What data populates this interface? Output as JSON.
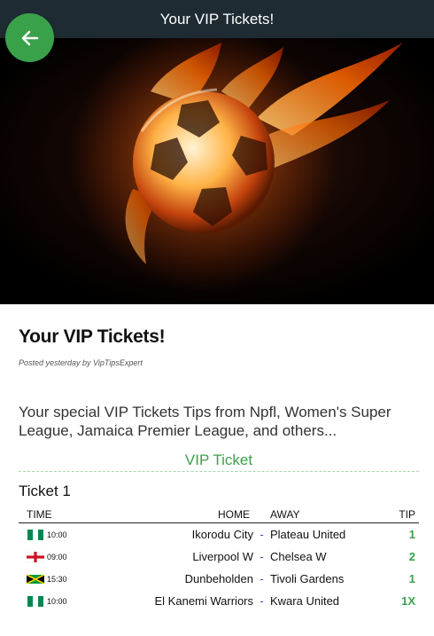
{
  "header": {
    "title": "Your VIP Tickets!"
  },
  "post": {
    "title": "Your VIP Tickets!",
    "meta": "Posted yesterday by VipTipsExpert",
    "intro": "Your special VIP Tickets Tips from Npfl, Women's Super League, Jamaica Premier League, and others..."
  },
  "section": {
    "title": "VIP Ticket"
  },
  "ticket": {
    "name": "Ticket 1",
    "columns": {
      "time": "TIME",
      "home": "HOME",
      "away": "AWAY",
      "tip": "TIP"
    },
    "separator": "-",
    "rows": [
      {
        "flag": "nigeria-flag",
        "time": "10:00",
        "home": "Ikorodu City",
        "away": "Plateau United",
        "tip": "1"
      },
      {
        "flag": "england-flag",
        "time": "09:00",
        "home": "Liverpool W",
        "away": "Chelsea W",
        "tip": "2"
      },
      {
        "flag": "jamaica-flag",
        "time": "15:30",
        "home": "Dunbeholden",
        "away": "Tivoli Gardens",
        "tip": "1"
      },
      {
        "flag": "nigeria-flag",
        "time": "10:00",
        "home": "El Kanemi Warriors",
        "away": "Kwara United",
        "tip": "1X"
      }
    ]
  },
  "colors": {
    "accent": "#3aa14b",
    "topbar": "#1f2b33",
    "separator": "#2a52be"
  }
}
